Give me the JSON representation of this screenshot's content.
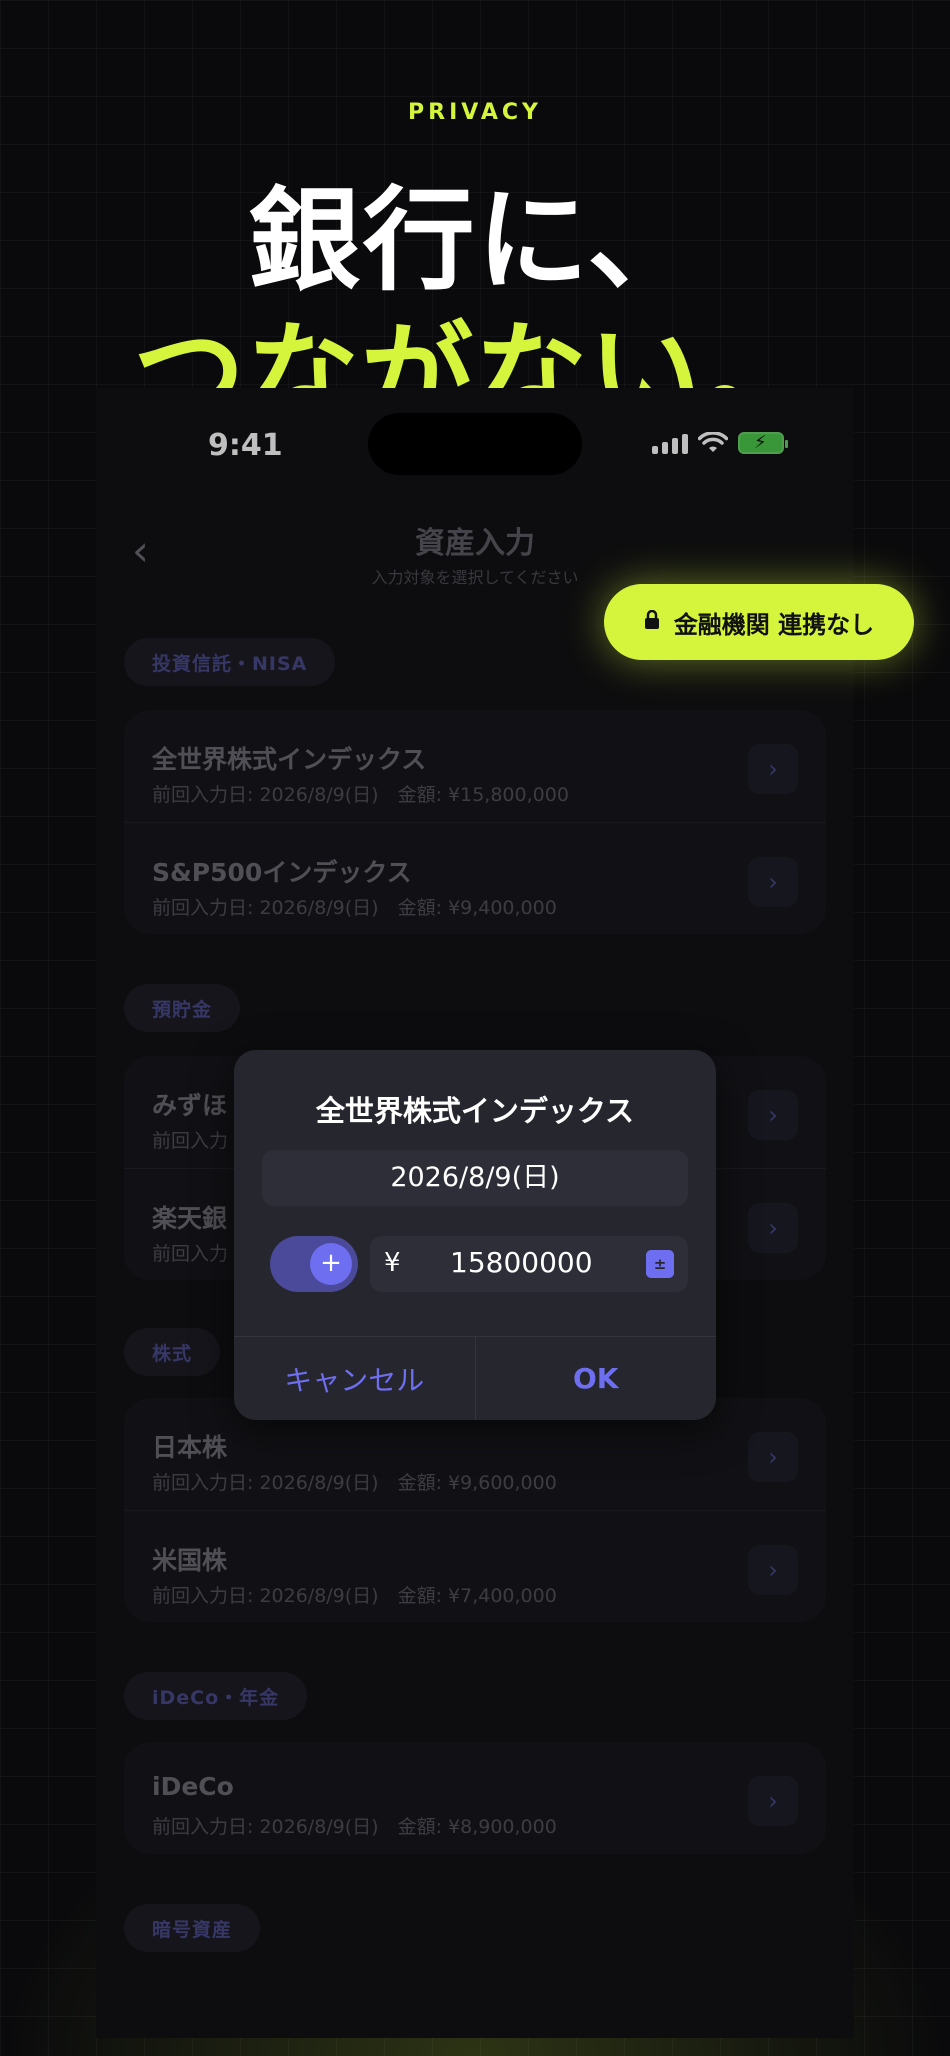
{
  "hero": {
    "eyebrow": "PRIVACY",
    "line1": "銀行に、",
    "line2": "つながない。"
  },
  "status_bar": {
    "time": "9:41"
  },
  "nav": {
    "back_icon": "chevron-left-icon",
    "title": "資産入力",
    "subtitle": "入力対象を選択してください"
  },
  "badge": {
    "label": "金融機関 連携なし",
    "icon": "lock-icon"
  },
  "sections": [
    {
      "tag": "投資信託・NISA",
      "rows": [
        {
          "name": "全世界株式インデックス",
          "meta": "前回入力日: 2026/8/9(日)　金額: ¥15,800,000"
        },
        {
          "name": "S&P500インデックス",
          "meta": "前回入力日: 2026/8/9(日)　金額: ¥9,400,000"
        }
      ]
    },
    {
      "tag": "預貯金",
      "rows": [
        {
          "name": "みずほ",
          "meta": "前回入力"
        },
        {
          "name": "楽天銀",
          "meta": "前回入力"
        }
      ]
    },
    {
      "tag": "株式",
      "rows": [
        {
          "name": "日本株",
          "meta": "前回入力日: 2026/8/9(日)　金額: ¥9,600,000"
        },
        {
          "name": "米国株",
          "meta": "前回入力日: 2026/8/9(日)　金額: ¥7,400,000"
        }
      ]
    },
    {
      "tag": "iDeCo・年金",
      "rows": [
        {
          "name": "iDeCo",
          "meta": "前回入力日: 2026/8/9(日)　金額: ¥8,900,000"
        }
      ]
    },
    {
      "tag": "暗号資産",
      "rows": []
    }
  ],
  "dialog": {
    "title": "全世界株式インデックス",
    "date": "2026/8/9(日)",
    "toggle_symbol": "+",
    "currency": "¥",
    "amount": "15800000",
    "cancel": "キャンセル",
    "ok": "OK"
  }
}
